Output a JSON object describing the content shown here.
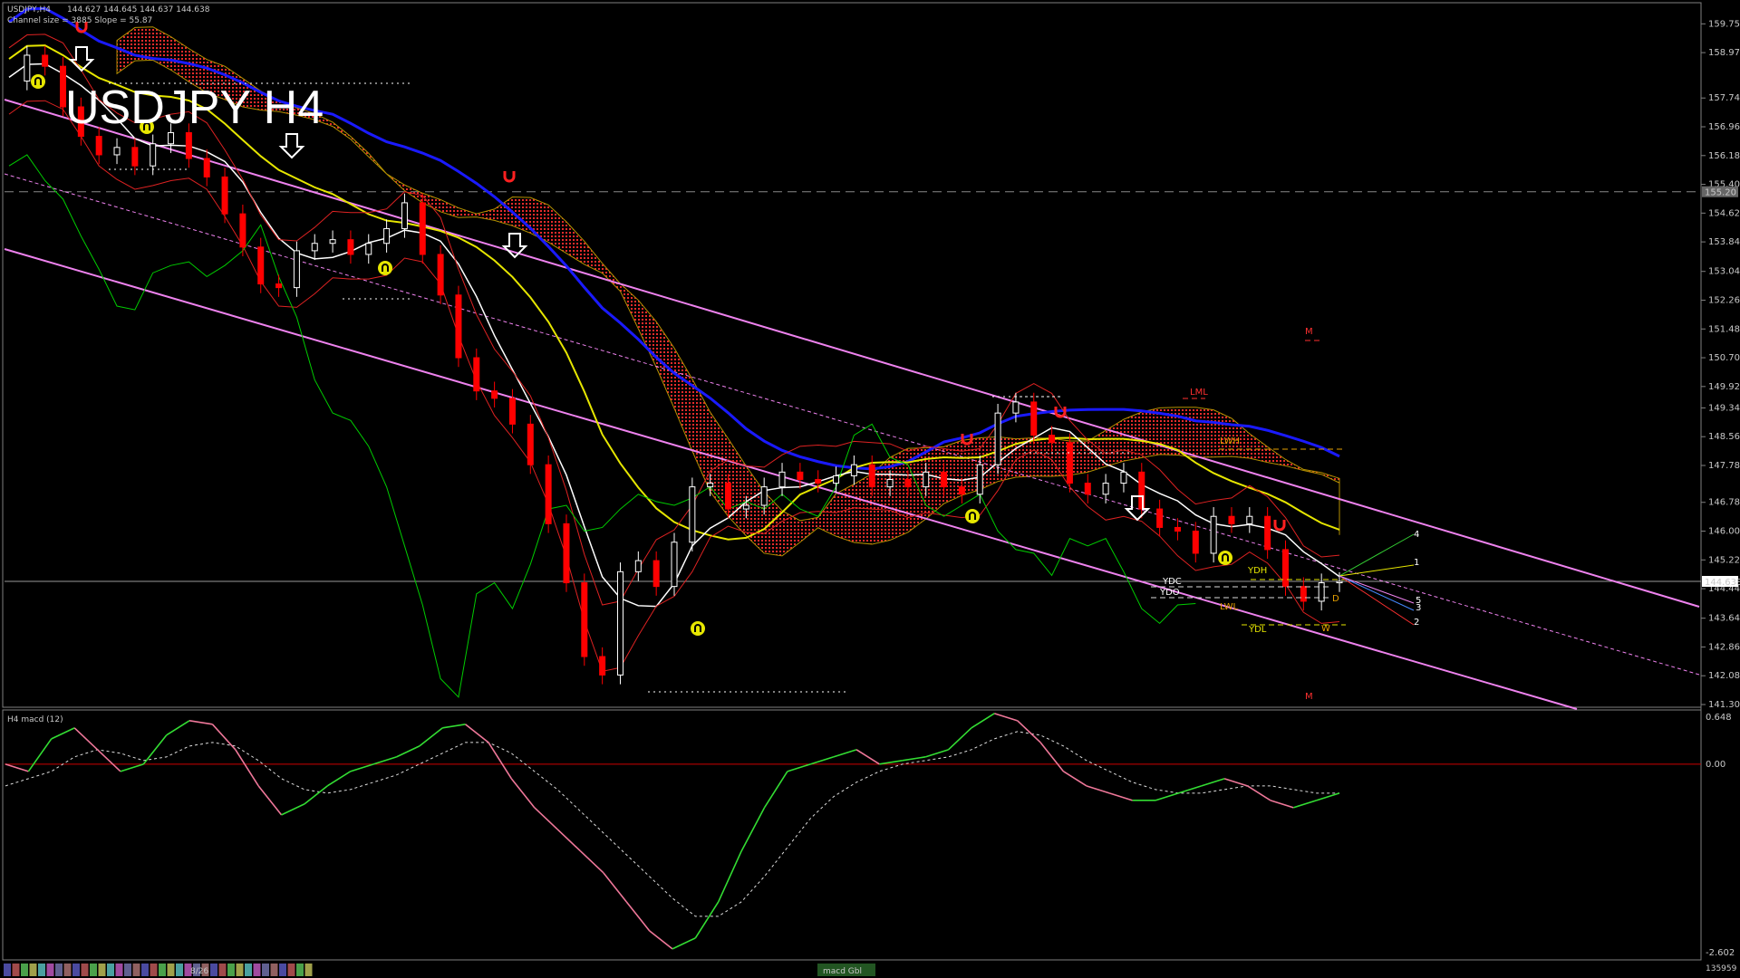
{
  "header": {
    "symbol": "USDJPY,H4",
    "ohlc": "144.627 144.645 144.637 144.638",
    "channel_info": "Channel size = 3885 Slope = 55.87",
    "watermark": "USDJPY H4"
  },
  "price_axis": {
    "ticks": [
      "159.750",
      "158.970",
      "157.740",
      "156.960",
      "156.180",
      "155.400",
      "154.620",
      "153.840",
      "153.040",
      "152.260",
      "151.480",
      "150.700",
      "149.920",
      "149.340",
      "148.560",
      "147.780",
      "146.780",
      "146.000",
      "145.220",
      "144.440",
      "143.640",
      "142.860",
      "142.080",
      "141.300"
    ],
    "current_price": "144.638",
    "dashed_level": "155.20",
    "ylim": [
      141.3,
      160.2
    ]
  },
  "macd_panel": {
    "title": "H4  macd (12)",
    "ticks": [
      "0.648",
      "0.00",
      "-2.602"
    ]
  },
  "bottom_bar": {
    "date_label": "8/26",
    "tab_label": "macd Gbl",
    "right_value": "135959"
  },
  "level_labels": [
    "LML",
    "LWH",
    "YDH",
    "YDC",
    "YDO",
    "LWL",
    "YDL",
    "M",
    "M",
    "D",
    "W",
    "1",
    "2",
    "3",
    "4",
    "5"
  ],
  "colors": {
    "background": "#000000",
    "bull_candle": "#ffffff",
    "bear_candle": "#ff0000",
    "ma_blue": "#1a1aff",
    "ma_yellow": "#e6e600",
    "ma_white": "#ffffff",
    "channel": "#ee82ee",
    "cloud": "#ff3030",
    "chikou": "#00cc00",
    "macd_up": "#33dd33",
    "macd_down": "#ee7799"
  },
  "chart_data": {
    "type": "line",
    "title": "USDJPY H4",
    "ylim": [
      141.3,
      160.2
    ],
    "series": [
      {
        "name": "price",
        "values": [
          158.2,
          158.9,
          158.6,
          157.5,
          156.7,
          156.2,
          156.4,
          155.9,
          156.5,
          156.8,
          156.1,
          155.6,
          154.6,
          153.7,
          152.7,
          152.6,
          153.6,
          153.8,
          153.9,
          153.5,
          153.8,
          154.2,
          154.9,
          153.5,
          152.4,
          150.7,
          149.8,
          149.6,
          148.9,
          147.8,
          146.2,
          144.6,
          142.6,
          142.1,
          144.9,
          145.2,
          144.5,
          145.7,
          147.2,
          147.3,
          146.6,
          146.7,
          147.2,
          147.6,
          147.4,
          147.3,
          147.5,
          147.8,
          147.2,
          147.4,
          147.2,
          147.6,
          147.2,
          147.0,
          147.8,
          149.2,
          149.5,
          148.6,
          148.4,
          147.3,
          147.0,
          147.3,
          147.6,
          146.6,
          146.1,
          146.0,
          145.4,
          146.4,
          146.2,
          146.4,
          145.5,
          144.5,
          144.1,
          144.6,
          144.638
        ]
      },
      {
        "name": "macd",
        "values": [
          0.0,
          -0.1,
          0.35,
          0.5,
          0.2,
          -0.1,
          0.0,
          0.4,
          0.6,
          0.55,
          0.2,
          -0.3,
          -0.7,
          -0.55,
          -0.3,
          -0.1,
          0.0,
          0.1,
          0.25,
          0.5,
          0.55,
          0.3,
          -0.2,
          -0.6,
          -0.9,
          -1.2,
          -1.5,
          -1.9,
          -2.3,
          -2.55,
          -2.4,
          -1.9,
          -1.2,
          -0.6,
          -0.1,
          0.0,
          0.1,
          0.2,
          0.0,
          0.05,
          0.1,
          0.2,
          0.5,
          0.7,
          0.6,
          0.3,
          -0.1,
          -0.3,
          -0.4,
          -0.5,
          -0.5,
          -0.4,
          -0.3,
          -0.2,
          -0.3,
          -0.5,
          -0.6,
          -0.5,
          -0.4
        ]
      },
      {
        "name": "signal",
        "values": [
          -0.3,
          -0.2,
          -0.1,
          0.1,
          0.2,
          0.15,
          0.05,
          0.1,
          0.25,
          0.3,
          0.25,
          0.05,
          -0.2,
          -0.35,
          -0.4,
          -0.35,
          -0.25,
          -0.15,
          0.0,
          0.15,
          0.3,
          0.3,
          0.15,
          -0.1,
          -0.35,
          -0.65,
          -0.95,
          -1.25,
          -1.55,
          -1.85,
          -2.1,
          -2.1,
          -1.9,
          -1.55,
          -1.15,
          -0.75,
          -0.45,
          -0.25,
          -0.1,
          0.0,
          0.05,
          0.1,
          0.2,
          0.35,
          0.45,
          0.4,
          0.25,
          0.05,
          -0.1,
          -0.25,
          -0.35,
          -0.4,
          -0.4,
          -0.35,
          -0.3,
          -0.3,
          -0.35,
          -0.4,
          -0.4
        ]
      }
    ]
  }
}
